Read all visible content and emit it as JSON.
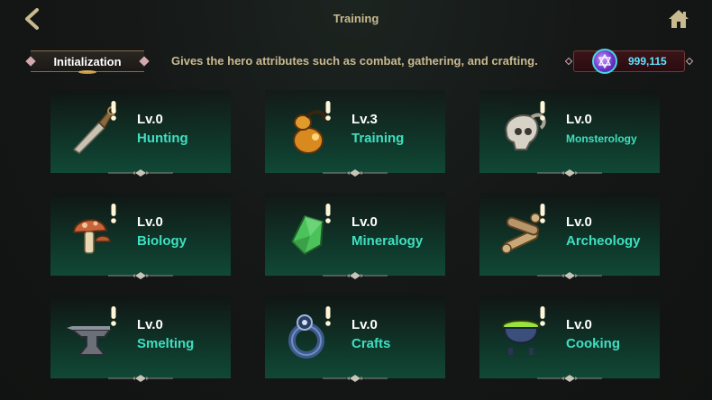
{
  "header": {
    "title": "Training"
  },
  "tab": {
    "label": "Initialization"
  },
  "description": "Gives the hero attributes such as combat, gathering, and crafting.",
  "currency": {
    "amount": "999,115",
    "icon": "star-of-david-gem-icon"
  },
  "skills": [
    {
      "level": "Lv.0",
      "name": "Hunting",
      "icon": "dagger-icon"
    },
    {
      "level": "Lv.3",
      "name": "Training",
      "icon": "gourd-icon"
    },
    {
      "level": "Lv.0",
      "name": "Monsterology",
      "icon": "skull-icon"
    },
    {
      "level": "Lv.0",
      "name": "Biology",
      "icon": "mushroom-icon"
    },
    {
      "level": "Lv.0",
      "name": "Mineralogy",
      "icon": "crystal-icon"
    },
    {
      "level": "Lv.0",
      "name": "Archeology",
      "icon": "bones-icon"
    },
    {
      "level": "Lv.0",
      "name": "Smelting",
      "icon": "anvil-icon"
    },
    {
      "level": "Lv.0",
      "name": "Crafts",
      "icon": "ring-icon"
    },
    {
      "level": "Lv.0",
      "name": "Cooking",
      "icon": "cauldron-icon"
    }
  ],
  "colors": {
    "accent_name": "#3ee0c0",
    "card_bg": "#114836",
    "currency_text": "#5fe3ff"
  }
}
